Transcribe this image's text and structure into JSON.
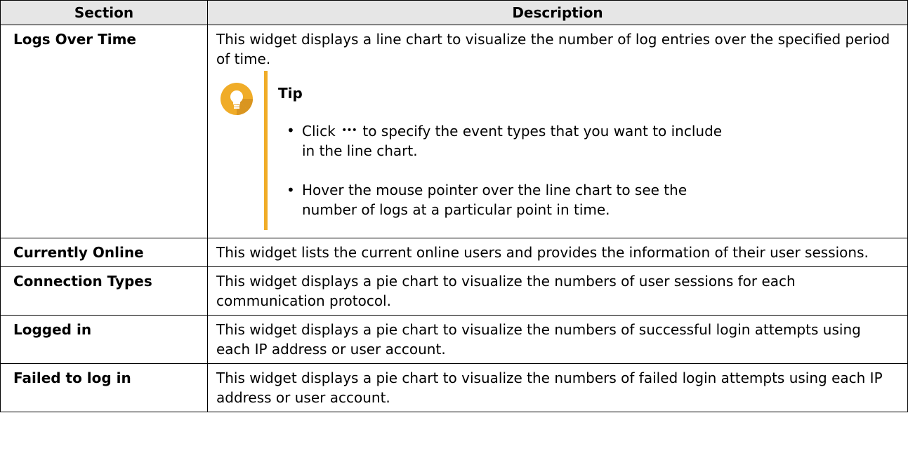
{
  "table": {
    "headers": [
      "Section",
      "Description"
    ],
    "rows": [
      {
        "section": "Logs Over Time",
        "description": "This widget displays a line chart to visualize the number of log entries over the specified period of time."
      },
      {
        "section": "Currently Online",
        "description": "This widget lists the current online users and provides the information of their user sessions."
      },
      {
        "section": "Connection Types",
        "description": "This widget displays a pie chart to visualize the numbers of user sessions for each communication protocol."
      },
      {
        "section": "Logged in",
        "description": "This widget displays a pie chart to visualize the numbers of successful login attempts using each IP address or user account."
      },
      {
        "section": "Failed to log in",
        "description": "This widget displays a pie chart to visualize the numbers of failed login attempts using each IP address or user account."
      }
    ]
  },
  "tip": {
    "title": "Tip",
    "icon": "lightbulb-icon",
    "accent_color": "#f0ac28",
    "item1": {
      "before": "Click",
      "icon": "more-options-icon",
      "line1_after": "to specify the event types that you want to include",
      "line2": "in the line chart."
    },
    "item2": {
      "line1": "Hover the mouse pointer over the line chart to see the",
      "line2": "number of logs at a particular point in time."
    }
  }
}
